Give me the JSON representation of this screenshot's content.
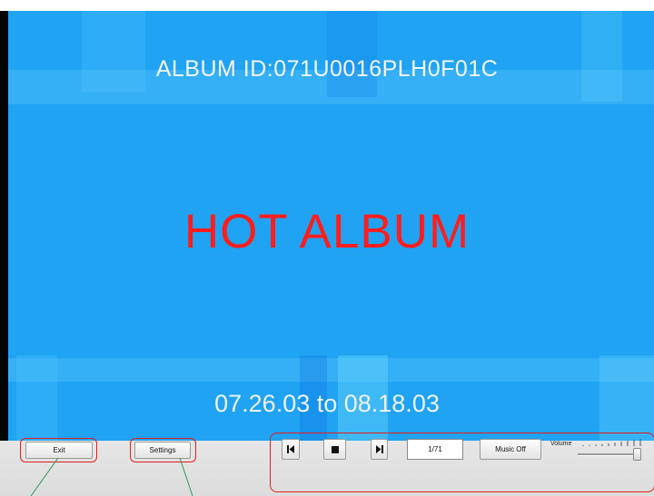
{
  "slide": {
    "album_id": "ALBUM ID:071U0016PLH0F01C",
    "title": "HOT ALBUM",
    "date_range": "07.26.03 to 08.18.03"
  },
  "controls": {
    "exit_label": "Exit",
    "settings_label": "Settings",
    "prev_icon": "skip-previous-icon",
    "stop_icon": "stop-icon",
    "next_icon": "skip-next-icon",
    "counter": "1/71",
    "music_label": "Music Off",
    "volume_label": "Volume",
    "volume_level": 1.0
  },
  "colors": {
    "background": "#1fa3f2",
    "title": "#ff1d1d",
    "highlight_outline": "#e51c1c",
    "callout_line": "#2e9a63"
  }
}
